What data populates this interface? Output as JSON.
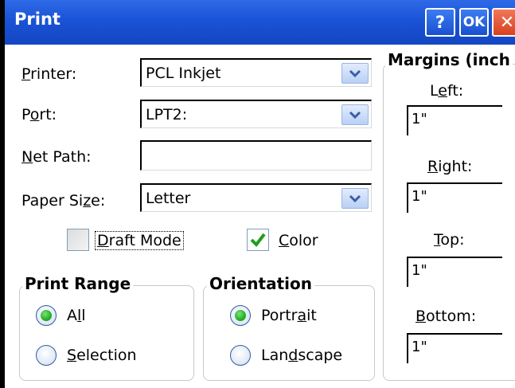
{
  "window": {
    "title": "Print",
    "help_label": "?",
    "ok_label": "OK",
    "close_label": "✕"
  },
  "printer": {
    "label": "Printer:",
    "value": "PCL Inkjet"
  },
  "port": {
    "label": "Port:",
    "value": "LPT2:"
  },
  "net_path": {
    "label": "Net Path:",
    "value": ""
  },
  "paper_size": {
    "label": "Paper Size:",
    "value": "Letter"
  },
  "draft_mode": {
    "label": "Draft Mode",
    "checked": false
  },
  "color_option": {
    "label": "Color",
    "checked": true
  },
  "print_range": {
    "title": "Print Range",
    "options": [
      {
        "label": "All",
        "selected": true
      },
      {
        "label": "Selection",
        "selected": false
      }
    ]
  },
  "orientation": {
    "title": "Orientation",
    "options": [
      {
        "label": "Portrait",
        "selected": true
      },
      {
        "label": "Landscape",
        "selected": false
      }
    ]
  },
  "margins": {
    "title": "Margins (inch",
    "left": {
      "label": "Left:",
      "value": "1\""
    },
    "right": {
      "label": "Right:",
      "value": "1\""
    },
    "top": {
      "label": "Top:",
      "value": "1\""
    },
    "bottom": {
      "label": "Bottom:",
      "value": "1\""
    }
  },
  "icons": {
    "dropdown": "chevron-down-icon",
    "check": "check-icon",
    "radio_dot": "radio-selected-icon"
  },
  "colors": {
    "titlebar": "#1a53d6",
    "close_button": "#d8411f",
    "check_green": "#1e9e1e",
    "radio_green": "#24b124"
  }
}
